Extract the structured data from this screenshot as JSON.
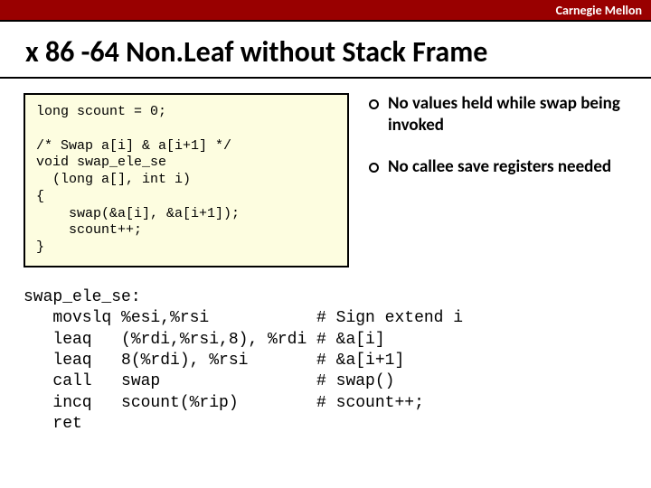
{
  "header": {
    "brand": "Carnegie Mellon"
  },
  "title": "x 86 -64 Non.Leaf without Stack Frame",
  "code_c": "long scount = 0;\n\n/* Swap a[i] & a[i+1] */\nvoid swap_ele_se\n  (long a[], int i)\n{\n    swap(&a[i], &a[i+1]);\n    scount++;\n}",
  "bullets": [
    "No values held while swap being invoked",
    "No callee save registers needed"
  ],
  "asm": "swap_ele_se:\n   movslq %esi,%rsi           # Sign extend i\n   leaq   (%rdi,%rsi,8), %rdi # &a[i]\n   leaq   8(%rdi), %rsi       # &a[i+1]\n   call   swap                # swap()\n   incq   scount(%rip)        # scount++;\n   ret"
}
